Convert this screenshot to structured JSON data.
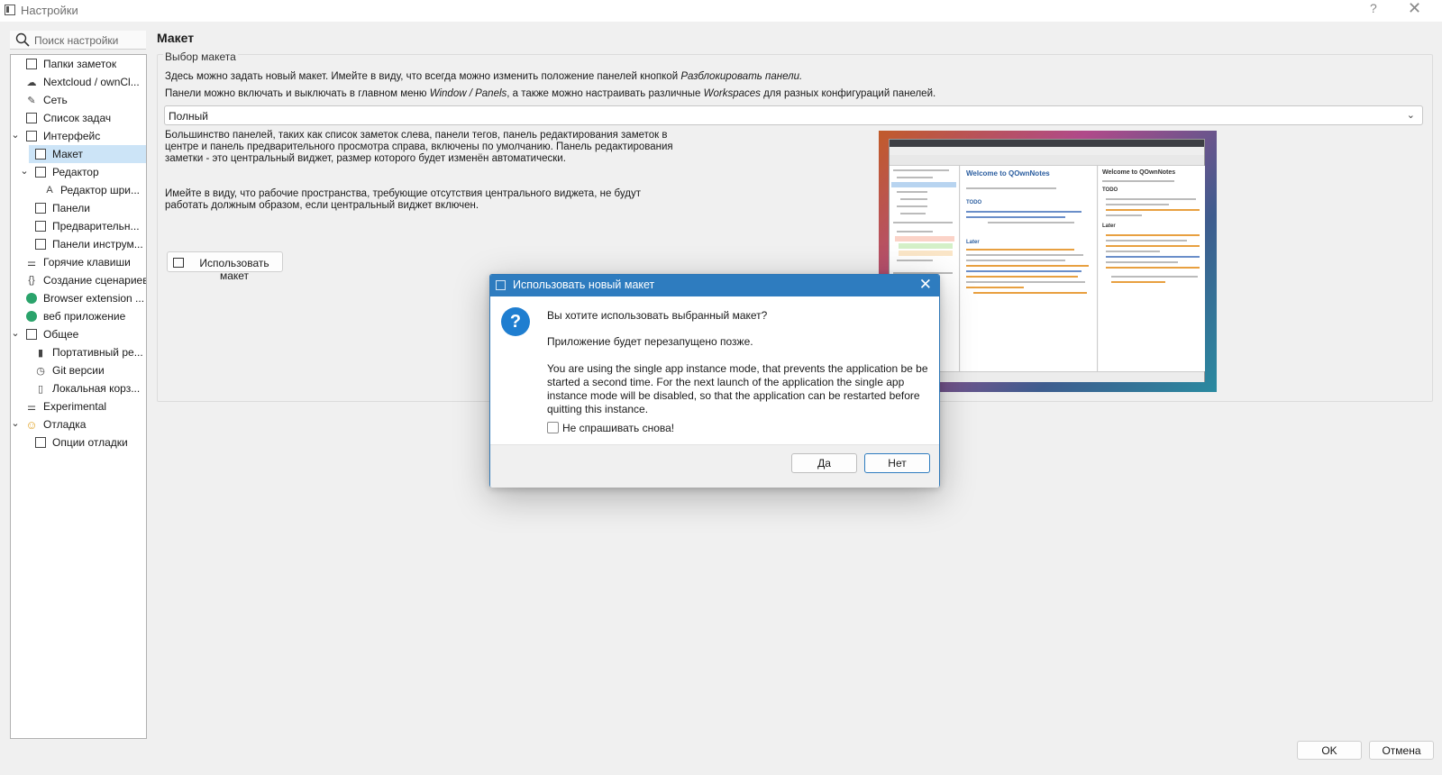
{
  "window": {
    "title": "Настройки",
    "help": "?",
    "close": "✕"
  },
  "search": {
    "placeholder": "Поиск настройки"
  },
  "sidebar": {
    "items": [
      {
        "label": "Папки заметок",
        "icon": "folder-icon"
      },
      {
        "label": "Nextcloud / ownCl...",
        "icon": "cloud-icon"
      },
      {
        "label": "Сеть",
        "icon": "network-icon"
      },
      {
        "label": "Список задач",
        "icon": "todo-list-icon"
      },
      {
        "label": "Интерфейс",
        "icon": "interface-icon",
        "expanded": true
      },
      {
        "label": "Макет",
        "icon": "layout-icon",
        "selected": true
      },
      {
        "label": "Редактор",
        "icon": "editor-icon",
        "expanded": true
      },
      {
        "label": "Редактор шри...",
        "icon": "font-icon"
      },
      {
        "label": "Панели",
        "icon": "panels-icon"
      },
      {
        "label": "Предварительн...",
        "icon": "preview-icon"
      },
      {
        "label": "Панели инструм...",
        "icon": "toolbar-icon"
      },
      {
        "label": "Горячие клавиши",
        "icon": "shortcut-icon"
      },
      {
        "label": "Создание сценариев",
        "icon": "script-icon"
      },
      {
        "label": "Browser extension ...",
        "icon": "browser-extension-icon"
      },
      {
        "label": "веб приложение",
        "icon": "web-app-icon"
      },
      {
        "label": "Общее",
        "icon": "general-icon",
        "expanded": true
      },
      {
        "label": "Портативный ре...",
        "icon": "portable-icon"
      },
      {
        "label": "Git версии",
        "icon": "git-icon"
      },
      {
        "label": "Локальная корз...",
        "icon": "trash-icon"
      },
      {
        "label": "Experimental",
        "icon": "experimental-icon"
      },
      {
        "label": "Отладка",
        "icon": "debug-icon",
        "expanded": true
      },
      {
        "label": "Опции отладки",
        "icon": "debug-options-icon"
      }
    ]
  },
  "main": {
    "title": "Макет",
    "group_title": "Выбор макета",
    "line1_a": "Здесь можно задать новый макет. Имейте в виду, что всегда можно изменить положение панелей кнопкой ",
    "line1_em": "Разблокировать панели.",
    "line2_a": "Панели можно включать и выключать в главном меню ",
    "line2_em1": "Window / Panels",
    "line2_b": ", а также можно настраивать различные ",
    "line2_em2": "Workspaces",
    "line2_c": " для разных конфигураций панелей.",
    "layout_select": "Полный",
    "description_lines": [
      "Большинство панелей, таких как список заметок слева, панели тегов, панель редактирования заметок в",
      "центре и панель предварительного просмотра справа, включены по умолчанию. Панель редактирования",
      "заметки - это центральный виджет, размер которого будет изменён автоматически."
    ],
    "note_lines": [
      "Имейте в виду, что рабочие пространства, требующие отсутствия центрального виджета, не будут",
      "работать должным образом, если центральный виджет включен."
    ],
    "use_layout_button": "Использовать макет",
    "preview": {
      "heading_mid": "Welcome to QOwnNotes",
      "heading_right": "Welcome to QOwnNotes",
      "todo_mid": "TODO",
      "todo_right": "TODO",
      "later_mid": "Later",
      "later_right": "Later"
    }
  },
  "dialog": {
    "title": "Использовать новый макет",
    "question": "Вы хотите использовать выбранный макет?",
    "restart_note": "Приложение будет перезапущено позже.",
    "details": "You are using the single app instance mode, that prevents the application be be started a second time. For the next launch of the application the single app instance mode will be disabled, so that the application can be restarted before quitting this instance.",
    "dont_ask": "Не спрашивать снова!",
    "yes": "Да",
    "no": "Нет"
  },
  "footer": {
    "ok": "OK",
    "cancel": "Отмена"
  },
  "colors": {
    "accent": "#2e7cbf",
    "selection": "#cce4f7",
    "question_icon": "#1f7ed0"
  }
}
